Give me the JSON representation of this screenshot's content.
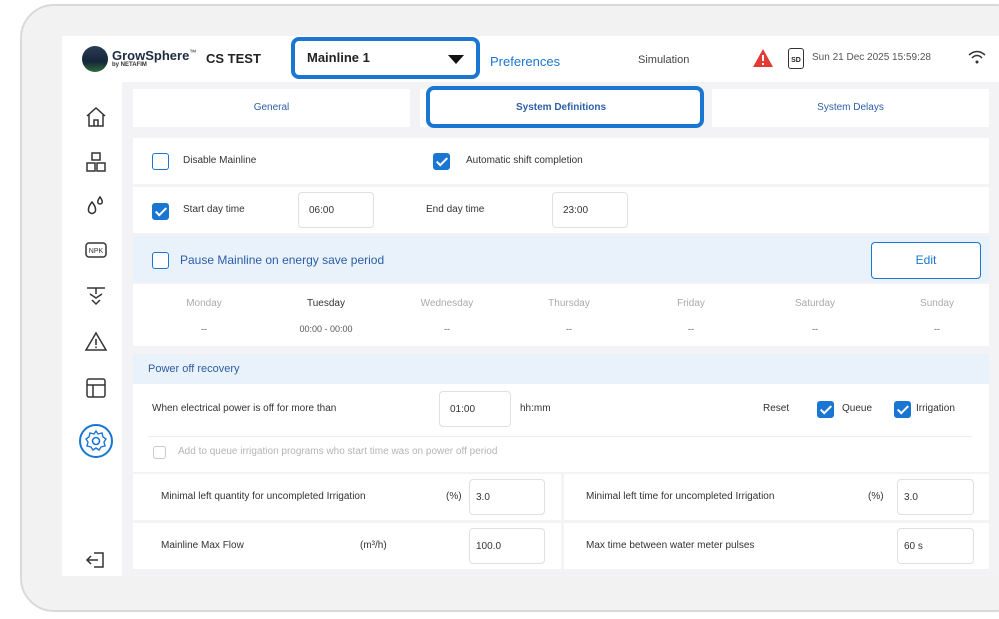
{
  "header": {
    "brand": "GrowSphere",
    "brand_tm": "™",
    "brand_sub": "by NETAFIM",
    "site": "CS TEST",
    "mainline": "Mainline 1",
    "nav_preferences": "Preferences",
    "nav_simulation": "Simulation",
    "sd_label": "SD",
    "datetime": "Sun 21 Dec 2025  15:59:28"
  },
  "sidebar": {
    "icons": [
      "home-icon",
      "plants-icon",
      "water-drops-icon",
      "npk-icon",
      "valves-icon",
      "alarm-icon",
      "layout-icon",
      "settings-icon",
      "logout-icon"
    ],
    "npk_label": "NPK",
    "active": "settings-icon"
  },
  "tabs": [
    {
      "label": "General",
      "active": false
    },
    {
      "label": "System Definitions",
      "active": true
    },
    {
      "label": "System Delays",
      "active": false
    }
  ],
  "options": {
    "disable_mainline": {
      "label": "Disable Mainline",
      "checked": false
    },
    "auto_shift": {
      "label": "Automatic shift completion",
      "checked": true
    },
    "start_day": {
      "label": "Start day time",
      "checked": true,
      "value": "06:00"
    },
    "end_day": {
      "label": "End day time",
      "value": "23:00"
    },
    "pause_mainline": {
      "label": "Pause Mainline on energy save period",
      "checked": false
    },
    "edit_label": "Edit"
  },
  "week": [
    {
      "day": "Monday",
      "value": "--",
      "active": false
    },
    {
      "day": "Tuesday",
      "value": "00:00 - 00:00",
      "active": true
    },
    {
      "day": "Wednesday",
      "value": "--",
      "active": false
    },
    {
      "day": "Thursday",
      "value": "--",
      "active": false
    },
    {
      "day": "Friday",
      "value": "--",
      "active": false
    },
    {
      "day": "Saturday",
      "value": "--",
      "active": false
    },
    {
      "day": "Sunday",
      "value": "--",
      "active": false
    }
  ],
  "power_recovery": {
    "title": "Power off recovery",
    "power_off_label": "When electrical power is off for more than",
    "power_off_value": "01:00",
    "unit": "hh:mm",
    "reset_label": "Reset",
    "queue_label": "Queue",
    "queue_checked": true,
    "irrigation_label": "Irrigation",
    "irrigation_checked": true,
    "add_queue_label": "Add to queue irrigation programs who start time was on power off period"
  },
  "limits": {
    "min_qty_label": "Minimal left quantity for uncompleted Irrigation",
    "min_qty_unit": "(%)",
    "min_qty_value": "3.0",
    "min_time_label": "Minimal left time for uncompleted Irrigation",
    "min_time_unit": "(%)",
    "min_time_value": "3.0",
    "max_flow_label": "Mainline Max Flow",
    "max_flow_unit": "(m³/h)",
    "max_flow_value": "100.0",
    "max_pulse_label": "Max time between water meter pulses",
    "max_pulse_value": "60 s"
  },
  "colors": {
    "accent": "#1976d2",
    "alert": "#e53935"
  }
}
